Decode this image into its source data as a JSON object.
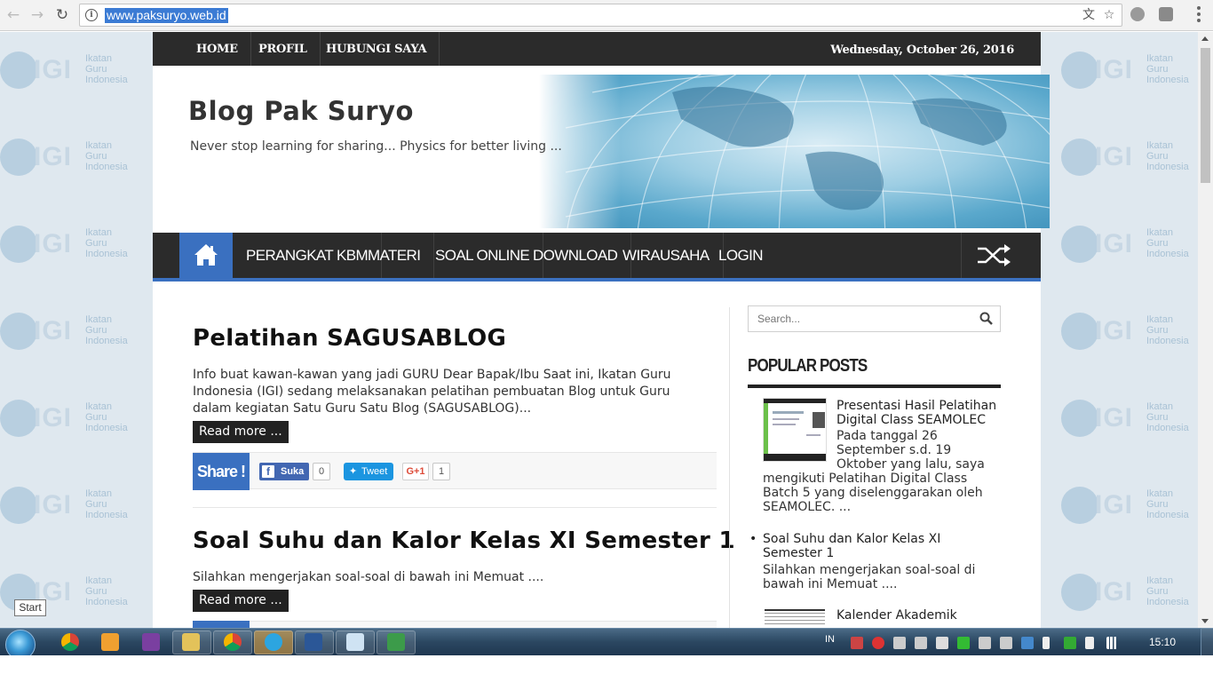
{
  "browser": {
    "url": "www.paksuryo.web.id"
  },
  "background": {
    "igi_logo_text": "IGI",
    "igi_caption_1": "Ikatan",
    "igi_caption_2": "Guru",
    "igi_caption_3": "Indonesia"
  },
  "topbar": {
    "links": [
      "HOME",
      "PROFIL",
      "HUBUNGI SAYA"
    ],
    "date": "Wednesday, October 26, 2016"
  },
  "header": {
    "title": "Blog Pak Suryo",
    "description": "Never stop learning for sharing... Physics for better living ..."
  },
  "mainnav": {
    "items": [
      "PERANGKAT KBM",
      "MATERI",
      "SOAL ONLINE",
      "DOWNLOAD",
      "WIRAUSAHA",
      "LOGIN"
    ]
  },
  "posts": [
    {
      "title": "Pelatihan SAGUSABLOG",
      "excerpt": "Info buat kawan-kawan yang jadi GURU Dear Bapak/Ibu Saat ini, Ikatan Guru Indonesia (IGI) sedang melaksanakan pelatihan pembuatan Blog untuk Guru dalam kegiatan Satu Guru Satu Blog (SAGUSABLOG)...",
      "read_more": "Read more ..."
    },
    {
      "title": "Soal Suhu dan Kalor Kelas XI Semester 1",
      "excerpt": "Silahkan mengerjakan soal-soal di bawah ini Memuat ....",
      "read_more": "Read more ..."
    }
  ],
  "share": {
    "label": "Share !",
    "fb_label": "Suka",
    "fb_count": "0",
    "tweet_label": "Tweet",
    "gplus_label": "G+1",
    "gplus_count": "1"
  },
  "sidebar": {
    "search_placeholder": "Search...",
    "popular_title": "POPULAR POSTS",
    "popular": [
      {
        "title": "Presentasi Hasil Pelatihan Digital Class SEAMOLEC",
        "snippet_a": "Pada tanggal 26 September s.d. 19 Oktober yang lalu, saya",
        "snippet_b": "mengikuti Pelatihan Digital Class Batch 5 yang diselenggarakan oleh SEAMOLEC. ..."
      },
      {
        "title": "Soal Suhu dan Kalor Kelas XI Semester 1",
        "snippet_a": "Silahkan mengerjakan soal-soal di bawah ini Memuat ...."
      },
      {
        "title": "Kalender Akademik"
      }
    ]
  },
  "taskbar": {
    "start_tooltip": "Start",
    "language": "IN",
    "clock": "15:10"
  },
  "colors": {
    "accent": "#3a70c0",
    "dark_bar": "#2b2b2b",
    "taskbar": "#2b4761"
  }
}
